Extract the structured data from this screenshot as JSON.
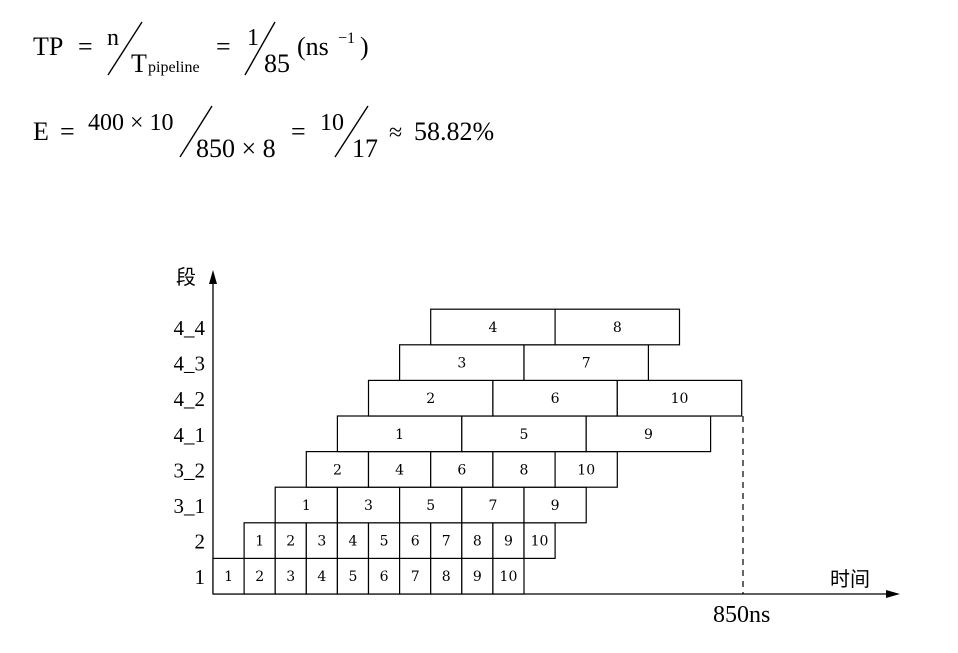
{
  "formulas": {
    "tp": {
      "lhs": "TP",
      "eq1": "=",
      "num1": "n",
      "den1": "T",
      "den1_sub": "pipeline",
      "eq2": "=",
      "num2": "1",
      "den2": "85",
      "unit": "(ns",
      "unit_exp": "−1",
      "unit_close": ")"
    },
    "e": {
      "lhs": "E",
      "eq1": "=",
      "num1": "400 × 10",
      "den1": "850 × 8",
      "eq2": "=",
      "num2": "10",
      "den2": "17",
      "approx": "≈",
      "result": "58.82%"
    }
  },
  "diagram": {
    "y_axis_label": "段",
    "x_axis_label": "时间",
    "end_label": "850ns",
    "stages": [
      "4_4",
      "4_3",
      "4_2",
      "4_1",
      "3_2",
      "3_1",
      "2",
      "1"
    ],
    "rows": [
      {
        "stage": "1",
        "start": 0,
        "width": 1,
        "tasks": [
          "1",
          "2",
          "3",
          "4",
          "5",
          "6",
          "7",
          "8",
          "9",
          "10"
        ]
      },
      {
        "stage": "2",
        "start": 1,
        "width": 1,
        "tasks": [
          "1",
          "2",
          "3",
          "4",
          "5",
          "6",
          "7",
          "8",
          "9",
          "10"
        ]
      },
      {
        "stage": "3_1",
        "start": 2,
        "width": 2,
        "tasks": [
          "1",
          "3",
          "5",
          "7",
          "9"
        ]
      },
      {
        "stage": "3_2",
        "start": 3,
        "width": 2,
        "tasks": [
          "2",
          "4",
          "6",
          "8",
          "10"
        ]
      },
      {
        "stage": "4_1",
        "start": 4,
        "width": 4,
        "tasks": [
          "1",
          "5",
          "9"
        ]
      },
      {
        "stage": "4_2",
        "start": 5,
        "width": 4,
        "tasks": [
          "2",
          "6",
          "10"
        ]
      },
      {
        "stage": "4_3",
        "start": 6,
        "width": 4,
        "tasks": [
          "3",
          "7"
        ]
      },
      {
        "stage": "4_4",
        "start": 7,
        "width": 4,
        "tasks": [
          "4",
          "8"
        ]
      }
    ]
  }
}
